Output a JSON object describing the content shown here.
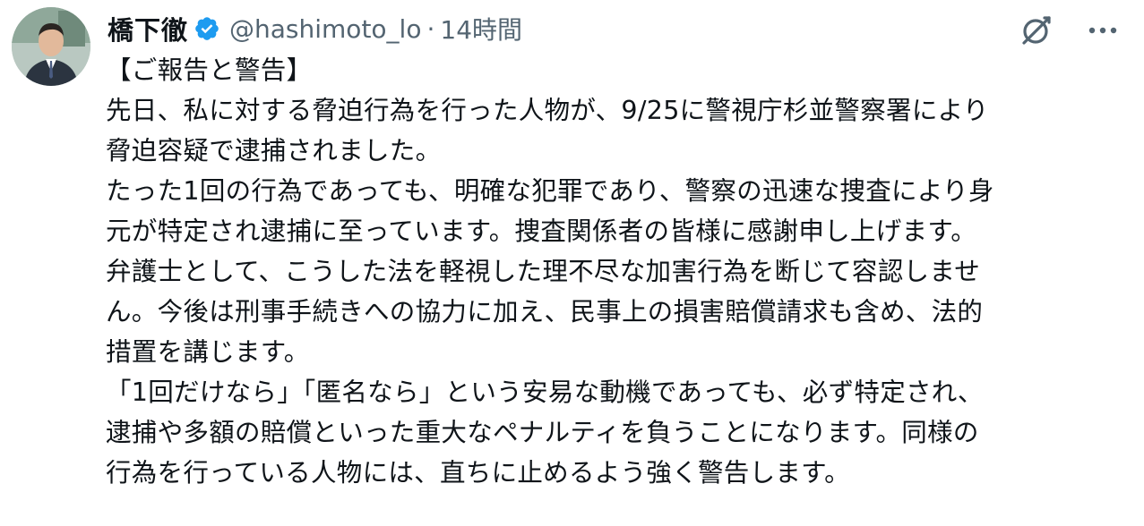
{
  "author": {
    "display_name": "橋下徹",
    "handle": "@hashimoto_lo",
    "separator": "·",
    "time": "14時間",
    "verified_icon": "verified-badge-icon",
    "verified_color": "#1d9bf0"
  },
  "actions": {
    "grok_icon": "grok-icon",
    "more_icon": "more-dots-icon",
    "more_glyph": "···"
  },
  "body": {
    "lines": [
      "【ご報告と警告】",
      "先日、私に対する脅迫行為を行った人物が、9/25に警視庁杉並警察署により",
      "脅迫容疑で逮捕されました。",
      "たった1回の行為であっても、明確な犯罪であり、警察の迅速な捜査により身",
      "元が特定され逮捕に至っています。捜査関係者の皆様に感謝申し上げます。",
      "弁護士として、こうした法を軽視した理不尽な加害行為を断じて容認しませ",
      "ん。今後は刑事手続きへの協力に加え、民事上の損害賠償請求も含め、法的",
      "措置を講じます。",
      "「1回だけなら」「匿名なら」という安易な動機であっても、必ず特定され、",
      "逮捕や多額の賠償といった重大なペナルティを負うことになります。同様の",
      "行為を行っている人物には、直ちに止めるよう強く警告します。"
    ]
  },
  "colors": {
    "text": "#0f1419",
    "secondary": "#536471",
    "accent": "#1d9bf0"
  }
}
